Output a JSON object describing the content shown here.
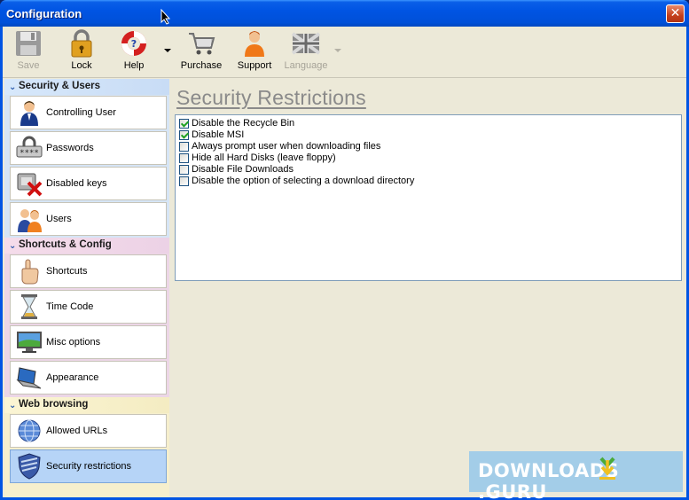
{
  "window": {
    "title": "Configuration",
    "close_glyph": "✕"
  },
  "toolbar": {
    "items": [
      {
        "label": "Save",
        "icon": "floppy-disk-icon",
        "enabled": false
      },
      {
        "label": "Lock",
        "icon": "padlock-icon",
        "enabled": true
      },
      {
        "label": "Help",
        "icon": "lifebuoy-icon",
        "enabled": true
      },
      {
        "label": "Purchase",
        "icon": "shopping-cart-icon",
        "enabled": true
      },
      {
        "label": "Support",
        "icon": "support-person-icon",
        "enabled": true
      },
      {
        "label": "Language",
        "icon": "uk-flag-icon",
        "enabled": false
      }
    ]
  },
  "sidebar": {
    "groups": [
      {
        "title": "Security & Users",
        "items": [
          {
            "label": "Controlling User",
            "icon": "user-icon"
          },
          {
            "label": "Passwords",
            "icon": "password-lock-icon"
          },
          {
            "label": "Disabled keys",
            "icon": "disabled-keys-icon"
          },
          {
            "label": "Users",
            "icon": "users-icon"
          }
        ]
      },
      {
        "title": "Shortcuts & Config",
        "items": [
          {
            "label": "Shortcuts",
            "icon": "pointing-hand-icon"
          },
          {
            "label": "Time Code",
            "icon": "hourglass-icon"
          },
          {
            "label": "Misc options",
            "icon": "monitor-icon"
          },
          {
            "label": "Appearance",
            "icon": "laptop-icon"
          }
        ]
      },
      {
        "title": "Web browsing",
        "items": [
          {
            "label": "Allowed URLs",
            "icon": "globe-icon"
          },
          {
            "label": "Security restrictions",
            "icon": "shield-icon",
            "selected": true
          }
        ]
      }
    ]
  },
  "main": {
    "title": "Security Restrictions",
    "options": [
      {
        "label": "Disable the Recycle Bin",
        "checked": true
      },
      {
        "label": "Disable MSI",
        "checked": true
      },
      {
        "label": "Always prompt user when downloading files",
        "checked": false
      },
      {
        "label": "Hide all Hard Disks (leave floppy)",
        "checked": false
      },
      {
        "label": "Disable File Downloads",
        "checked": false
      },
      {
        "label": "Disable the option of selecting a download directory",
        "checked": false
      }
    ]
  },
  "watermark": {
    "left": "DOWNLOADS",
    "right": ".GURU"
  },
  "colors": {
    "titlebar": "#0054e3",
    "selected_item": "#b6d4f7",
    "accent": "#8ab8e6"
  }
}
